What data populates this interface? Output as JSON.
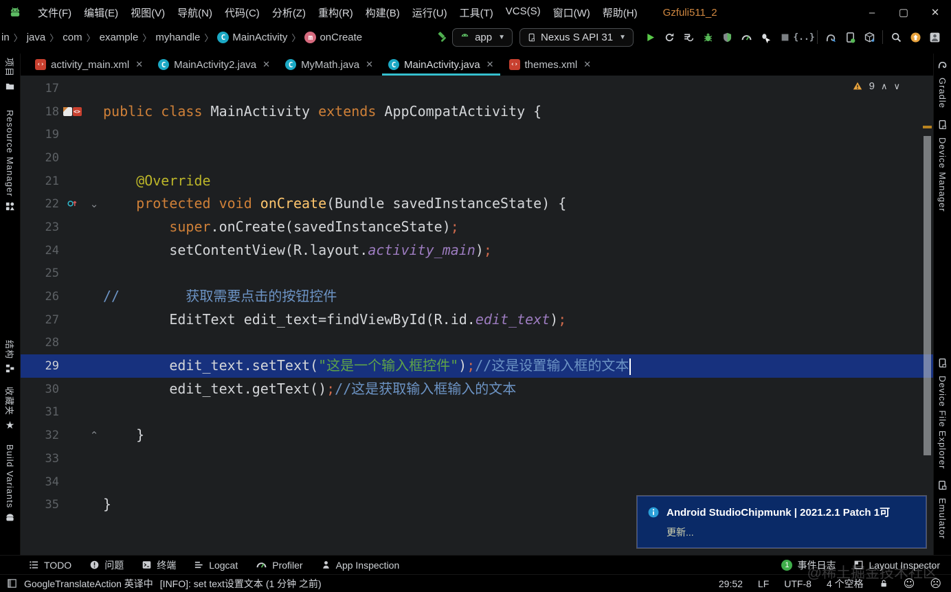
{
  "window": {
    "title": "Gzfuli511_2",
    "minimize": "–",
    "maximize": "▢",
    "close": "✕"
  },
  "menu": {
    "items": [
      "文件(F)",
      "编辑(E)",
      "视图(V)",
      "导航(N)",
      "代码(C)",
      "分析(Z)",
      "重构(R)",
      "构建(B)",
      "运行(U)",
      "工具(T)",
      "VCS(S)",
      "窗口(W)",
      "帮助(H)"
    ]
  },
  "breadcrumbs": [
    {
      "label": "in"
    },
    {
      "label": "java"
    },
    {
      "label": "com"
    },
    {
      "label": "example"
    },
    {
      "label": "myhandle"
    },
    {
      "label": "MainActivity",
      "badge": "C",
      "badge_kind": "class"
    },
    {
      "label": "onCreate",
      "badge": "m",
      "badge_kind": "method"
    }
  ],
  "toolbar": {
    "run_config": "app",
    "device": "Nexus S API 31",
    "actions": [
      {
        "name": "run",
        "icon": "play"
      },
      {
        "name": "rerun-activity",
        "icon": "rerun"
      },
      {
        "name": "apply-code-changes",
        "icon": "apply"
      },
      {
        "name": "debug",
        "icon": "bug"
      },
      {
        "name": "attach-debugger",
        "icon": "shield"
      },
      {
        "name": "profile",
        "icon": "gauge"
      },
      {
        "name": "profile-low-overhead",
        "icon": "bug-run"
      },
      {
        "name": "stop",
        "icon": "stop"
      },
      {
        "name": "running-devices",
        "icon": "braces"
      },
      {
        "name": "divider"
      },
      {
        "name": "sync-project",
        "icon": "elephant-sync"
      },
      {
        "name": "device-manager-toolbar",
        "icon": "phone-android"
      },
      {
        "name": "sdk-manager",
        "icon": "sdk-box"
      },
      {
        "name": "divider"
      },
      {
        "name": "search-everywhere",
        "icon": "search"
      },
      {
        "name": "ide-update",
        "icon": "update"
      },
      {
        "name": "user-avatar",
        "icon": "avatar"
      }
    ]
  },
  "tabs": [
    {
      "label": "activity_main.xml",
      "icon": "xml",
      "active": false
    },
    {
      "label": "MainActivity2.java",
      "icon": "java",
      "active": false
    },
    {
      "label": "MyMath.java",
      "icon": "java",
      "active": false
    },
    {
      "label": "MainActivity.java",
      "icon": "java",
      "active": true
    },
    {
      "label": "themes.xml",
      "icon": "xml",
      "active": false
    }
  ],
  "left_stripe": [
    {
      "label": "项目",
      "icon": "folder",
      "mt": 6
    },
    {
      "label": "Resource Manager",
      "icon": "resource",
      "mt": 22
    },
    {
      "label": "结构",
      "icon": "structure",
      "mt": 182
    },
    {
      "label": "收藏夹",
      "icon": "star",
      "mt": 14
    },
    {
      "label": "Build Variants",
      "icon": "android",
      "mt": 18
    }
  ],
  "right_stripe": [
    {
      "label": "Gradle",
      "icon": "elephant",
      "mt": 8
    },
    {
      "label": "Device Manager",
      "icon": "phone",
      "mt": 16
    },
    {
      "label": "Device File Explorer",
      "icon": "phone",
      "mt": 212
    },
    {
      "label": "Emulator",
      "icon": "phone2",
      "mt": 16
    }
  ],
  "editor": {
    "inspection": {
      "warnings": "9"
    },
    "lines": [
      {
        "n": "17",
        "tokens": []
      },
      {
        "n": "18",
        "icons": [
          "layout",
          "xml"
        ],
        "tokens": [
          {
            "t": "public class ",
            "c": "kw"
          },
          {
            "t": "MainActivity ",
            "c": "plain"
          },
          {
            "t": "extends ",
            "c": "kw"
          },
          {
            "t": "AppCompatActivity {",
            "c": "plain"
          }
        ]
      },
      {
        "n": "19",
        "tokens": []
      },
      {
        "n": "20",
        "tokens": []
      },
      {
        "n": "21",
        "tokens": [
          {
            "t": "    ",
            "c": "plain"
          },
          {
            "t": "@Override",
            "c": "ann"
          }
        ]
      },
      {
        "n": "22",
        "icons": [
          "override"
        ],
        "fold": "down",
        "tokens": [
          {
            "t": "    ",
            "c": "plain"
          },
          {
            "t": "protected void ",
            "c": "kw"
          },
          {
            "t": "onCreate",
            "c": "method"
          },
          {
            "t": "(Bundle savedInstanceState) {",
            "c": "plain"
          }
        ]
      },
      {
        "n": "23",
        "tokens": [
          {
            "t": "        ",
            "c": "plain"
          },
          {
            "t": "super",
            "c": "kw"
          },
          {
            "t": ".onCreate(savedInstanceState)",
            "c": "plain"
          },
          {
            "t": ";",
            "c": "semi"
          }
        ]
      },
      {
        "n": "24",
        "tokens": [
          {
            "t": "        setContentView(R.layout.",
            "c": "plain"
          },
          {
            "t": "activity_main",
            "c": "field"
          },
          {
            "t": ")",
            "c": "plain"
          },
          {
            "t": ";",
            "c": "semi"
          }
        ]
      },
      {
        "n": "25",
        "tokens": []
      },
      {
        "n": "26",
        "tokens": [
          {
            "t": "//",
            "c": "comment"
          },
          {
            "t": "        ",
            "c": "plain"
          },
          {
            "t": "获取需要点击的按钮控件",
            "c": "comment"
          }
        ]
      },
      {
        "n": "27",
        "tokens": [
          {
            "t": "        EditText edit_text=findViewById(R.id.",
            "c": "plain"
          },
          {
            "t": "edit_text",
            "c": "field"
          },
          {
            "t": ")",
            "c": "plain"
          },
          {
            "t": ";",
            "c": "semi"
          }
        ]
      },
      {
        "n": "28",
        "tokens": []
      },
      {
        "n": "29",
        "current": true,
        "caret": true,
        "tokens": [
          {
            "t": "        edit_text.setText(",
            "c": "plain"
          },
          {
            "t": "\"这是一个输入框控件\"",
            "c": "str"
          },
          {
            "t": ")",
            "c": "plain"
          },
          {
            "t": ";",
            "c": "semi"
          },
          {
            "t": "//这是设置输入框的文本",
            "c": "comment"
          }
        ]
      },
      {
        "n": "30",
        "tokens": [
          {
            "t": "        edit_text.getText()",
            "c": "plain"
          },
          {
            "t": ";",
            "c": "semi"
          },
          {
            "t": "//这是获取输入框输入的文本",
            "c": "comment"
          }
        ]
      },
      {
        "n": "31",
        "tokens": []
      },
      {
        "n": "32",
        "fold": "up",
        "tokens": [
          {
            "t": "    }",
            "c": "plain"
          }
        ]
      },
      {
        "n": "33",
        "tokens": []
      },
      {
        "n": "34",
        "tokens": []
      },
      {
        "n": "35",
        "tokens": [
          {
            "t": "}",
            "c": "plain"
          }
        ]
      }
    ]
  },
  "notification": {
    "title": "Android StudioChipmunk | 2021.2.1 Patch 1可",
    "link": "更新..."
  },
  "bottom_bar": {
    "left": [
      {
        "label": "TODO",
        "icon": "todo"
      },
      {
        "label": "问题",
        "icon": "problems"
      },
      {
        "label": "终端",
        "icon": "terminal"
      },
      {
        "label": "Logcat",
        "icon": "logcat"
      },
      {
        "label": "Profiler",
        "icon": "gauge"
      },
      {
        "label": "App Inspection",
        "icon": "person"
      }
    ],
    "right": [
      {
        "label": "事件日志",
        "icon": "badge",
        "badge": "1"
      },
      {
        "label": "Layout Inspector",
        "icon": "layout-inspector"
      }
    ]
  },
  "status_bar": {
    "plugin_label": "GoogleTranslateAction 英译中",
    "message": "[INFO]: set text设置文本 (1 分钟 之前)",
    "caret_position": "29:52",
    "line_separator": "LF",
    "encoding": "UTF-8",
    "indent": "4 个空格",
    "smile": "☺",
    "frown": "☹"
  },
  "watermark": "@稀土掘金技术社区",
  "colors": {
    "accent_cyan": "#35bfce",
    "selection_blue": "#17317e",
    "notification_bg": "#0a2a67",
    "warning_yellow": "#e8a33d",
    "run_green": "#59c949",
    "title_orange": "#cf8740",
    "keyword": "#cf8038",
    "string": "#5fa348",
    "comment": "#6c93c4",
    "field": "#9d7cc0"
  }
}
